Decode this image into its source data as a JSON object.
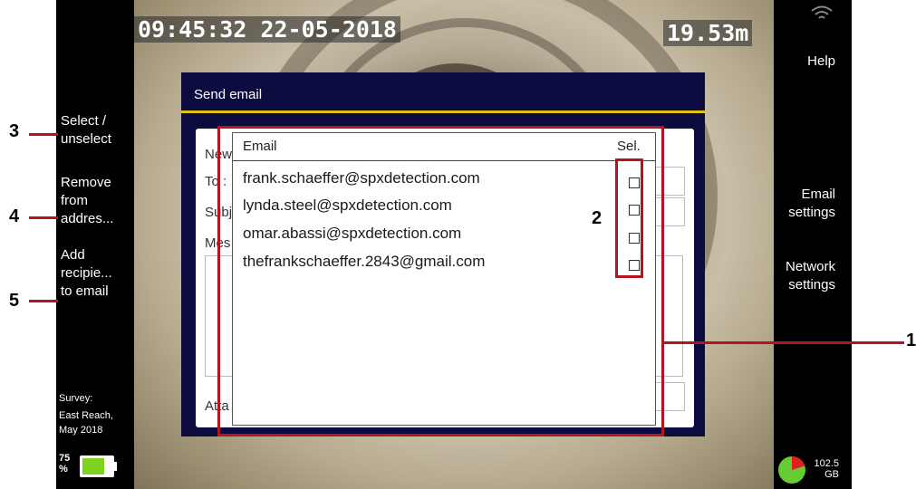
{
  "status": {
    "timestamp": "09:45:32 22-05-2018",
    "distance": "19.53m"
  },
  "left_menu": {
    "select_unselect": [
      "Select /",
      "unselect"
    ],
    "remove_from_address": [
      "Remove",
      "from",
      "addres..."
    ],
    "add_recipient": [
      "Add",
      "recipie...",
      "to email"
    ],
    "survey": [
      "Survey:",
      "East Reach,",
      "May 2018"
    ],
    "battery": {
      "value": "75",
      "unit": "%",
      "level": 0.75
    }
  },
  "right_menu": {
    "help": "Help",
    "email_settings": [
      "Email",
      "settings"
    ],
    "network_settings": [
      "Network",
      "settings"
    ],
    "storage": {
      "value": "102.5",
      "unit": "GB"
    },
    "icons": [
      "wifi-icon",
      "storage-pie-icon",
      "battery-icon"
    ]
  },
  "dialog": {
    "title": "Send email",
    "labels": [
      "New",
      "To :",
      "Subj",
      "Mes",
      "Atta"
    ]
  },
  "email_list": {
    "headers": {
      "email": "Email",
      "sel": "Sel."
    },
    "rows": [
      "frank.schaeffer@spxdetection.com",
      "lynda.steel@spxdetection.com",
      "omar.abassi@spxdetection.com",
      "thefrankschaeffer.2843@gmail.com"
    ]
  },
  "callouts": [
    "1",
    "2",
    "3",
    "4",
    "5"
  ],
  "colors": {
    "callout_red": "#b4141e",
    "dialog_navy": "#0b0b40",
    "dialog_accent": "#e6c20e",
    "battery_green": "#7ed321",
    "storage_green": "#66cc33",
    "storage_red": "#e02020"
  }
}
